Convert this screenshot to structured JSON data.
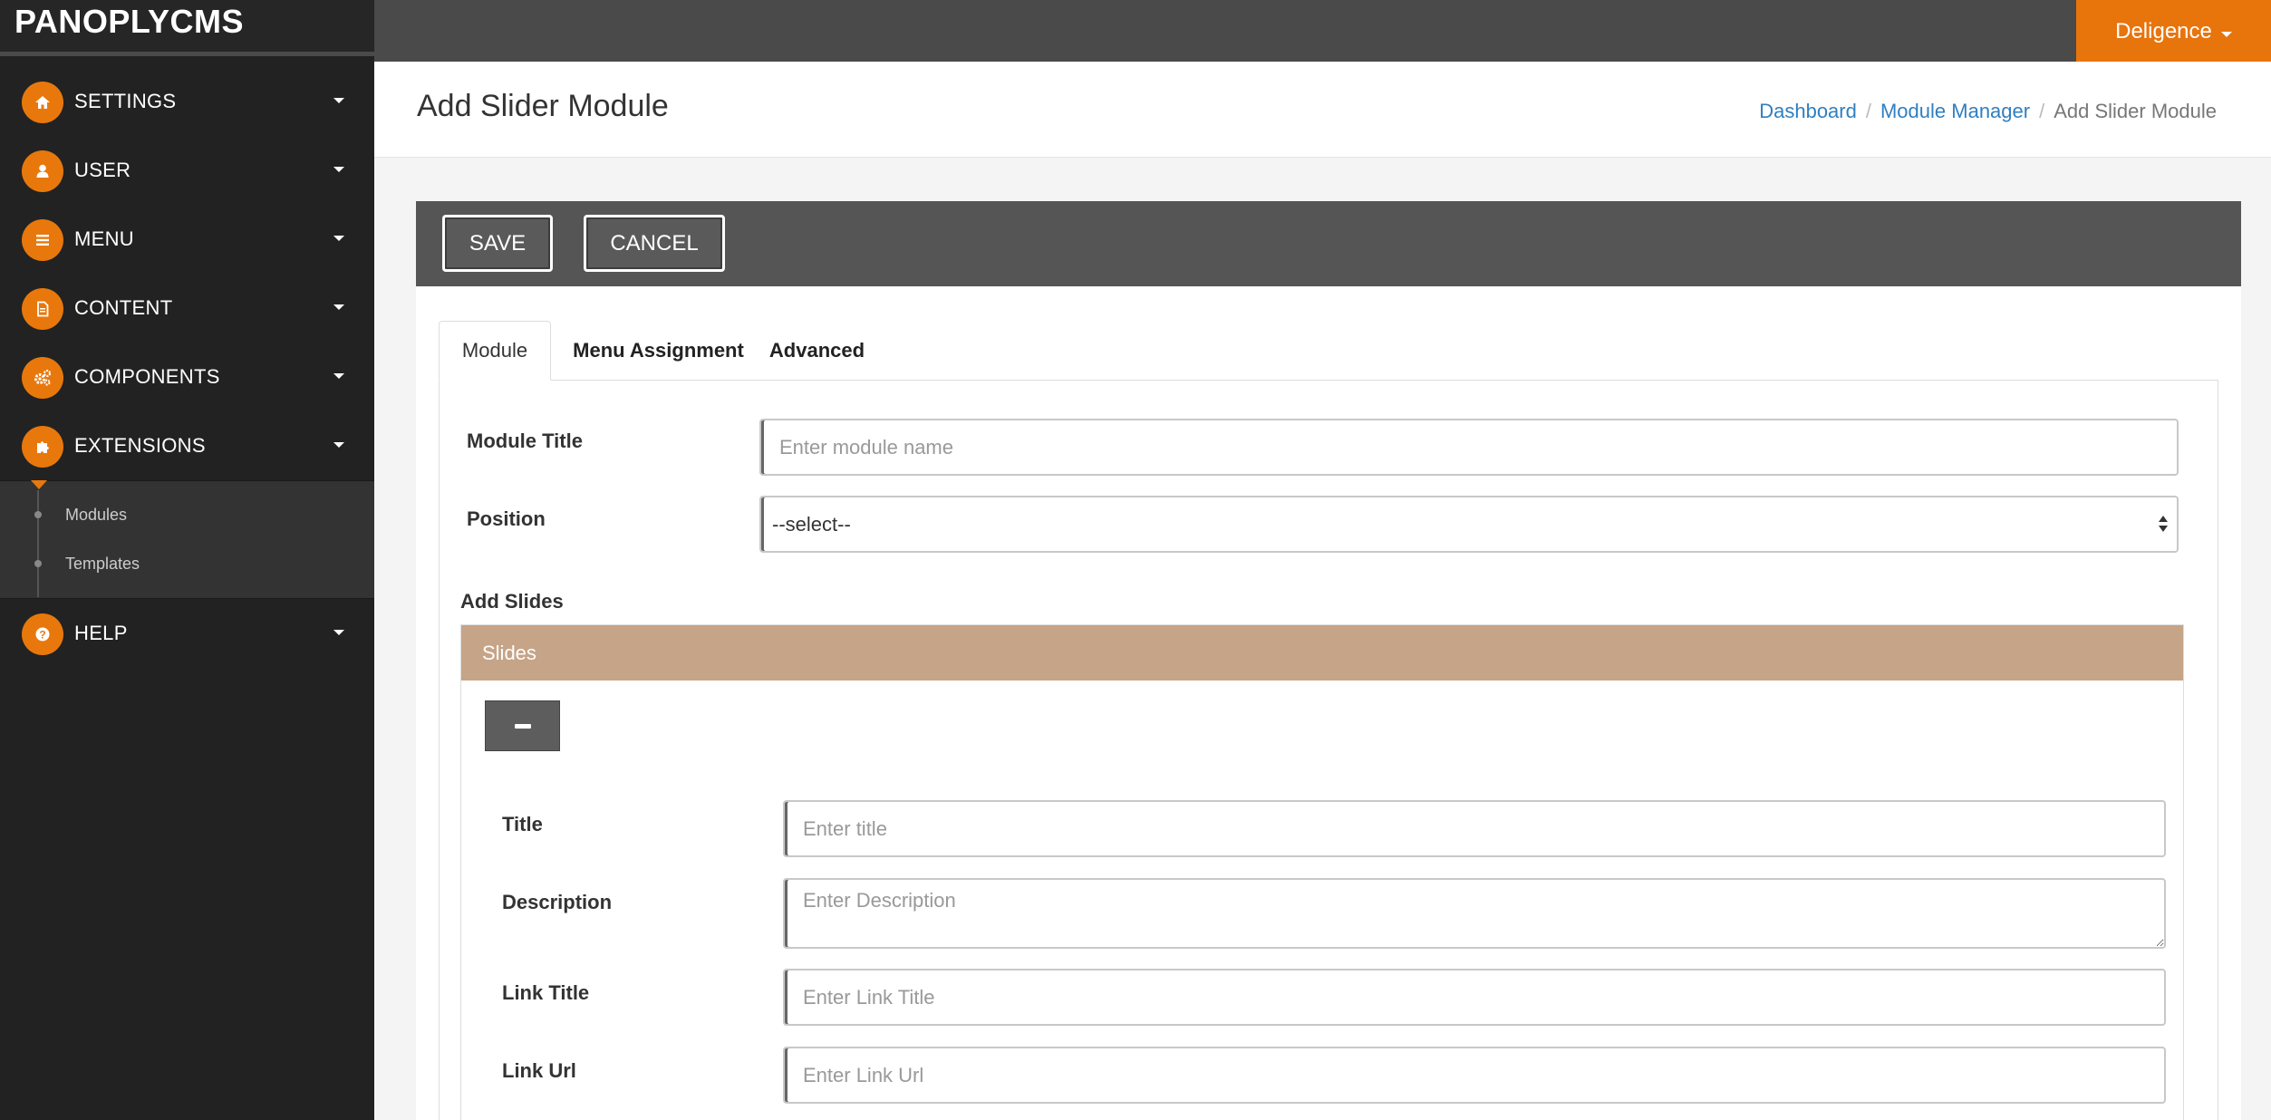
{
  "app": {
    "brand": "PANOPLYCMS"
  },
  "user_menu": {
    "label": "Deligence"
  },
  "sidebar": {
    "items": [
      {
        "label": "SETTINGS",
        "icon": "home-icon"
      },
      {
        "label": "USER",
        "icon": "user-icon"
      },
      {
        "label": "MENU",
        "icon": "menu-icon"
      },
      {
        "label": "CONTENT",
        "icon": "document-icon"
      },
      {
        "label": "COMPONENTS",
        "icon": "gears-icon"
      },
      {
        "label": "EXTENSIONS",
        "icon": "puzzle-icon"
      }
    ],
    "submenu": [
      {
        "label": "Modules"
      },
      {
        "label": "Templates"
      }
    ],
    "help": {
      "label": "HELP",
      "icon": "question-icon"
    }
  },
  "page": {
    "title": "Add Slider Module",
    "breadcrumb": [
      "Dashboard",
      "Module Manager",
      "Add Slider Module"
    ]
  },
  "toolbar": {
    "save_label": "SAVE",
    "cancel_label": "CANCEL"
  },
  "tabs": [
    "Module",
    "Menu Assignment",
    "Advanced"
  ],
  "form": {
    "module_title": {
      "label": "Module Title",
      "placeholder": "Enter module name"
    },
    "position": {
      "label": "Position",
      "value": "--select--"
    },
    "add_slides_label": "Add Slides",
    "slides": {
      "header": "Slides",
      "title": {
        "label": "Title",
        "placeholder": "Enter title"
      },
      "description": {
        "label": "Description",
        "placeholder": "Enter Description"
      },
      "link_title": {
        "label": "Link Title",
        "placeholder": "Enter Link Title"
      },
      "link_url": {
        "label": "Link Url",
        "placeholder": "Enter Link Url"
      }
    }
  },
  "colors": {
    "accent": "#e8780c",
    "sidebar_bg": "#222222",
    "topbar_bg": "#4a4a4a",
    "slides_header": "#c6a487",
    "link": "#2f7fc1"
  }
}
